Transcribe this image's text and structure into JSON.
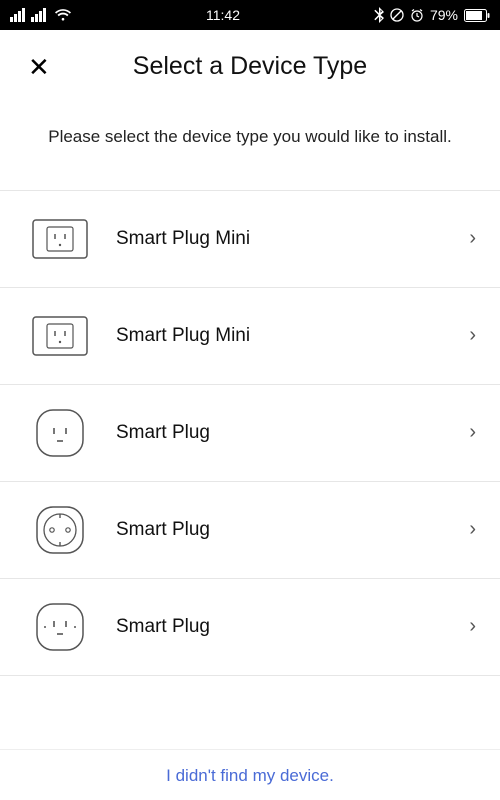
{
  "status_bar": {
    "time": "11:42",
    "battery_pct": "79%"
  },
  "header": {
    "title": "Select a Device Type"
  },
  "subtitle": "Please select the device type you would like to install.",
  "devices": [
    {
      "label": "Smart Plug Mini",
      "icon": "plug-rect-us"
    },
    {
      "label": "Smart Plug Mini",
      "icon": "plug-rect-us"
    },
    {
      "label": "Smart Plug",
      "icon": "plug-round-us"
    },
    {
      "label": "Smart Plug",
      "icon": "plug-round-eu"
    },
    {
      "label": "Smart Plug",
      "icon": "plug-round-us"
    }
  ],
  "footer": {
    "not_found": "I didn't find my device."
  }
}
